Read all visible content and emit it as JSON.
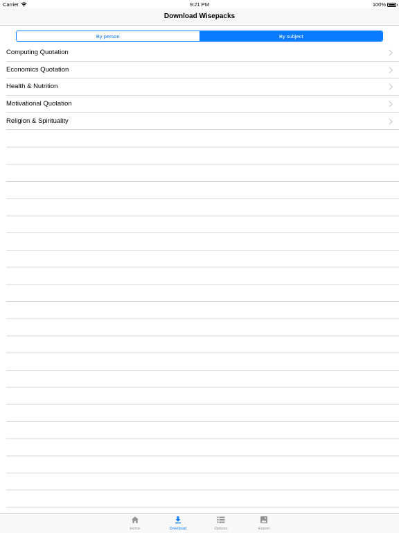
{
  "status_bar": {
    "carrier": "Carrier",
    "time": "9:21 PM",
    "battery": "100%"
  },
  "nav": {
    "title": "Download Wisepacks"
  },
  "segment": {
    "options": [
      "By person",
      "By subject"
    ],
    "selected": "By subject"
  },
  "list": {
    "items": [
      {
        "label": "Computing Quotation"
      },
      {
        "label": "Economics Quotation"
      },
      {
        "label": "Health & Nutrition"
      },
      {
        "label": "Motivational Quotation"
      },
      {
        "label": "Religion & Spirituality"
      }
    ]
  },
  "tab_bar": {
    "tabs": [
      {
        "label": "Home",
        "icon": "home-icon"
      },
      {
        "label": "Download",
        "icon": "download-icon"
      },
      {
        "label": "Options",
        "icon": "list-icon"
      },
      {
        "label": "Export",
        "icon": "image-icon"
      }
    ],
    "active": "Download"
  },
  "colors": {
    "accent": "#0a7aff",
    "inactive": "#929292",
    "separator": "#d9d9d9"
  }
}
